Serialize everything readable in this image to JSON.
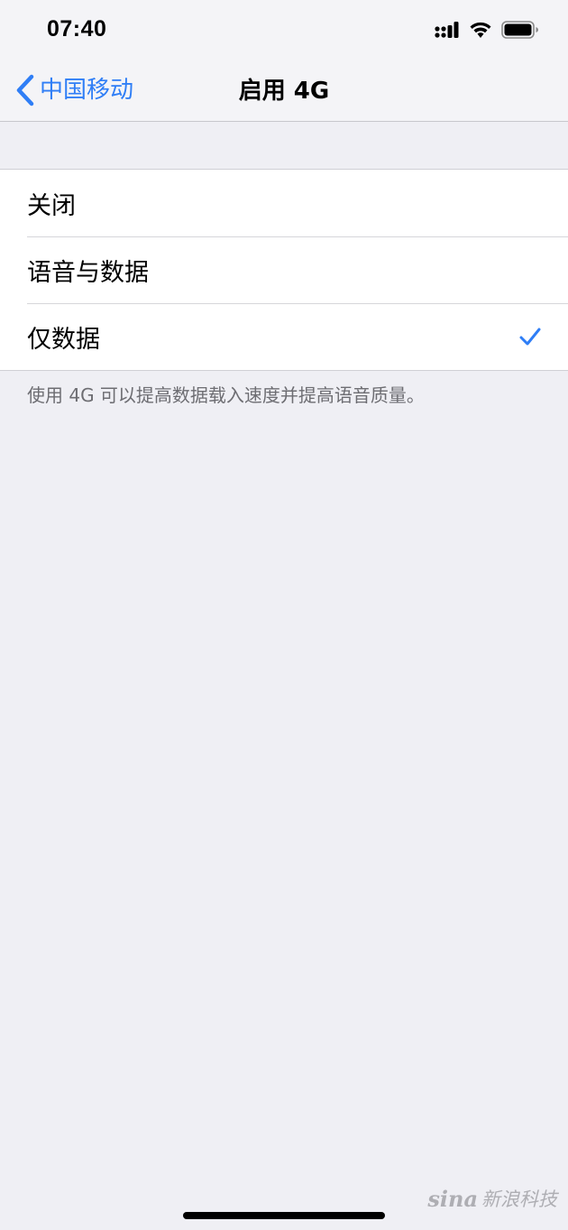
{
  "status_bar": {
    "time": "07:40",
    "icons": [
      "cellular-signal-icon",
      "wifi-icon",
      "battery-icon"
    ]
  },
  "nav": {
    "back_label": "中国移动",
    "title": "启用 4G"
  },
  "options": [
    {
      "label": "关闭",
      "selected": false
    },
    {
      "label": "语音与数据",
      "selected": false
    },
    {
      "label": "仅数据",
      "selected": true
    }
  ],
  "footer_note": "使用 4G 可以提高数据载入速度并提高语音质量。",
  "watermark": {
    "logo": "sina",
    "text": "新浪科技"
  },
  "colors": {
    "accent": "#2f7ef6",
    "background": "#efeff4",
    "secondary_text": "#6d6d72"
  }
}
